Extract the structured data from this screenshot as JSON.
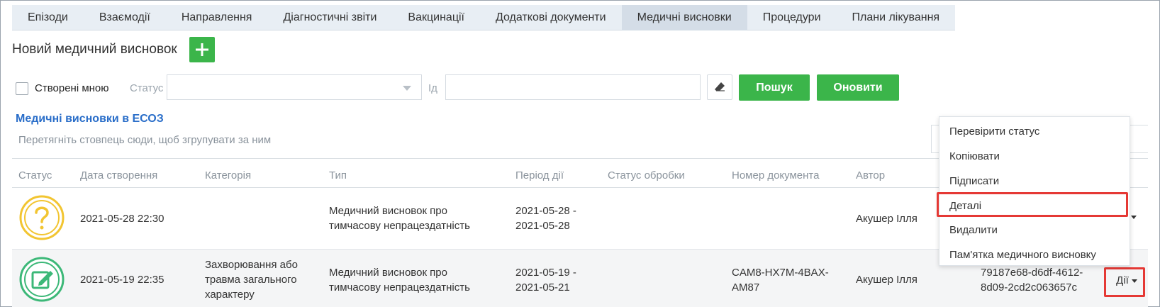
{
  "tabs": [
    {
      "label": "Епізоди",
      "active": false
    },
    {
      "label": "Взаємодії",
      "active": false
    },
    {
      "label": "Направлення",
      "active": false
    },
    {
      "label": "Діагностичні звіти",
      "active": false
    },
    {
      "label": "Вакцинації",
      "active": false
    },
    {
      "label": "Додаткові документи",
      "active": false
    },
    {
      "label": "Медичні висновки",
      "active": true
    },
    {
      "label": "Процедури",
      "active": false
    },
    {
      "label": "Плани лікування",
      "active": false
    }
  ],
  "new_section": {
    "title": "Новий медичний висновок",
    "add_icon": "plus-icon"
  },
  "filters": {
    "created_by_me_label": "Створені мною",
    "created_by_me_checked": false,
    "status_label": "Статус",
    "status_value": "",
    "id_label": "Ід",
    "id_value": "",
    "clear_icon": "eraser-icon",
    "search_label": "Пошук",
    "refresh_label": "Оновити"
  },
  "grid": {
    "title": "Медичні висновки в ЕСОЗ",
    "group_hint": "Перетягніть стовпець сюди, щоб згрупувати за ним",
    "columns": [
      "Статус",
      "Дата створення",
      "Категорія",
      "Тип",
      "Період дії",
      "Статус обробки",
      "Номер документа",
      "Автор"
    ],
    "rows": [
      {
        "status_icon": "question-icon",
        "created": "2021-05-28 22:30",
        "category": "",
        "type_line1": "Медичний висновок про",
        "type_line2": "тимчасову непрацездатність",
        "period_line1": "2021-05-28 -",
        "period_line2": "2021-05-28",
        "processing_status": "",
        "doc_number_line1": "",
        "doc_number_line2": "",
        "author": "Акушер Ілля"
      },
      {
        "status_icon": "edit-pen-icon",
        "created": "2021-05-19 22:35",
        "category_line1": "Захворювання або",
        "category_line2": "травма загального",
        "category_line3": "характеру",
        "type_line1": "Медичний висновок про",
        "type_line2": "тимчасову непрацездатність",
        "period_line1": "2021-05-19 -",
        "period_line2": "2021-05-21",
        "processing_status": "",
        "doc_number_line1": "CAM8-HX7M-4BAX-",
        "doc_number_line2": "AM87",
        "author": "Акушер Ілля",
        "id_line1": "79187e68-d6df-4612-",
        "id_line2": "8d09-2cd2c063657c",
        "actions_label": "Дії"
      }
    ]
  },
  "actions_menu": {
    "items": [
      "Перевірити статус",
      "Копіювати",
      "Підписати",
      "Деталі",
      "Видалити",
      "Пам'ятка медичного висновку"
    ],
    "highlighted": "Деталі"
  },
  "colors": {
    "accent_green": "#3bb54a",
    "link_blue": "#2a6ec9",
    "highlight_red": "#e53935",
    "status_yellow": "#f2c531",
    "status_green": "#3cb878"
  }
}
